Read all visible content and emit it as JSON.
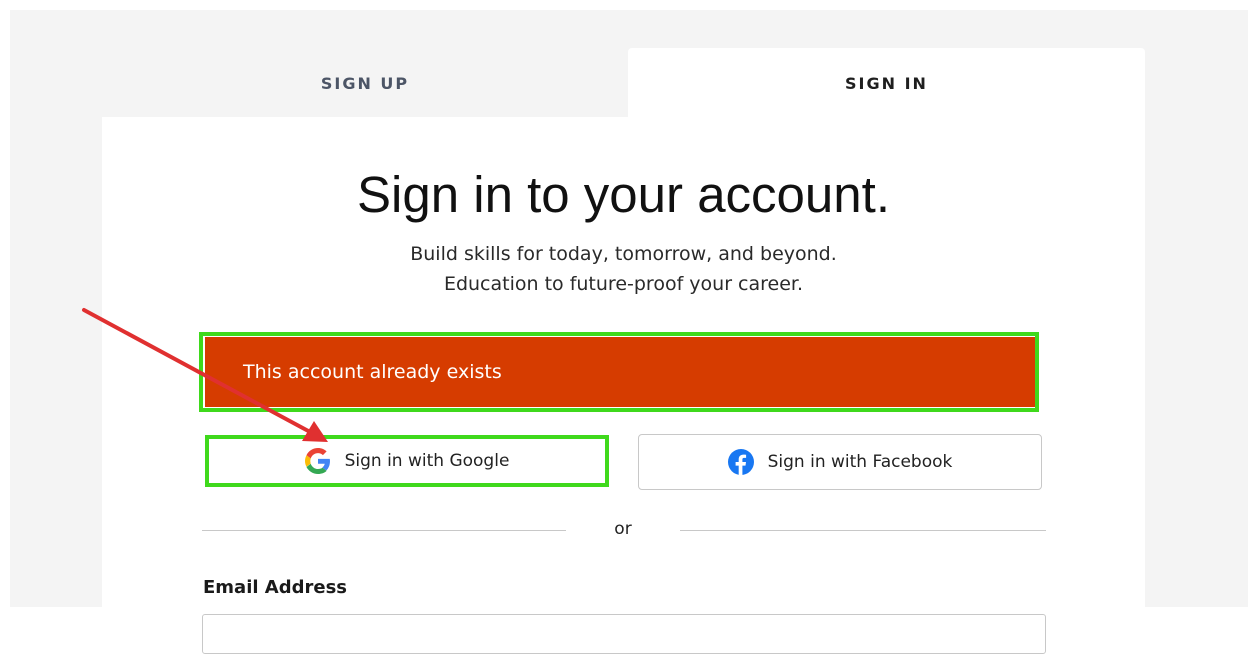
{
  "tabs": {
    "sign_up": "SIGN UP",
    "sign_in": "SIGN IN"
  },
  "heading": {
    "title": "Sign in to your account.",
    "subtitle_line1": "Build skills for today, tomorrow, and beyond.",
    "subtitle_line2": "Education to future-proof your career."
  },
  "alert": {
    "message": "This account already exists",
    "color": "#d63c00"
  },
  "social": {
    "google_label": "Sign in with Google",
    "google_icon": "google-icon",
    "facebook_label": "Sign in with Facebook",
    "facebook_icon": "facebook-icon",
    "facebook_color": "#1877f2"
  },
  "divider": {
    "or_label": "or"
  },
  "form": {
    "email_label": "Email Address",
    "email_value": ""
  },
  "annotations": {
    "highlight_color": "#3fd91c",
    "arrow_color": "#e03030"
  }
}
